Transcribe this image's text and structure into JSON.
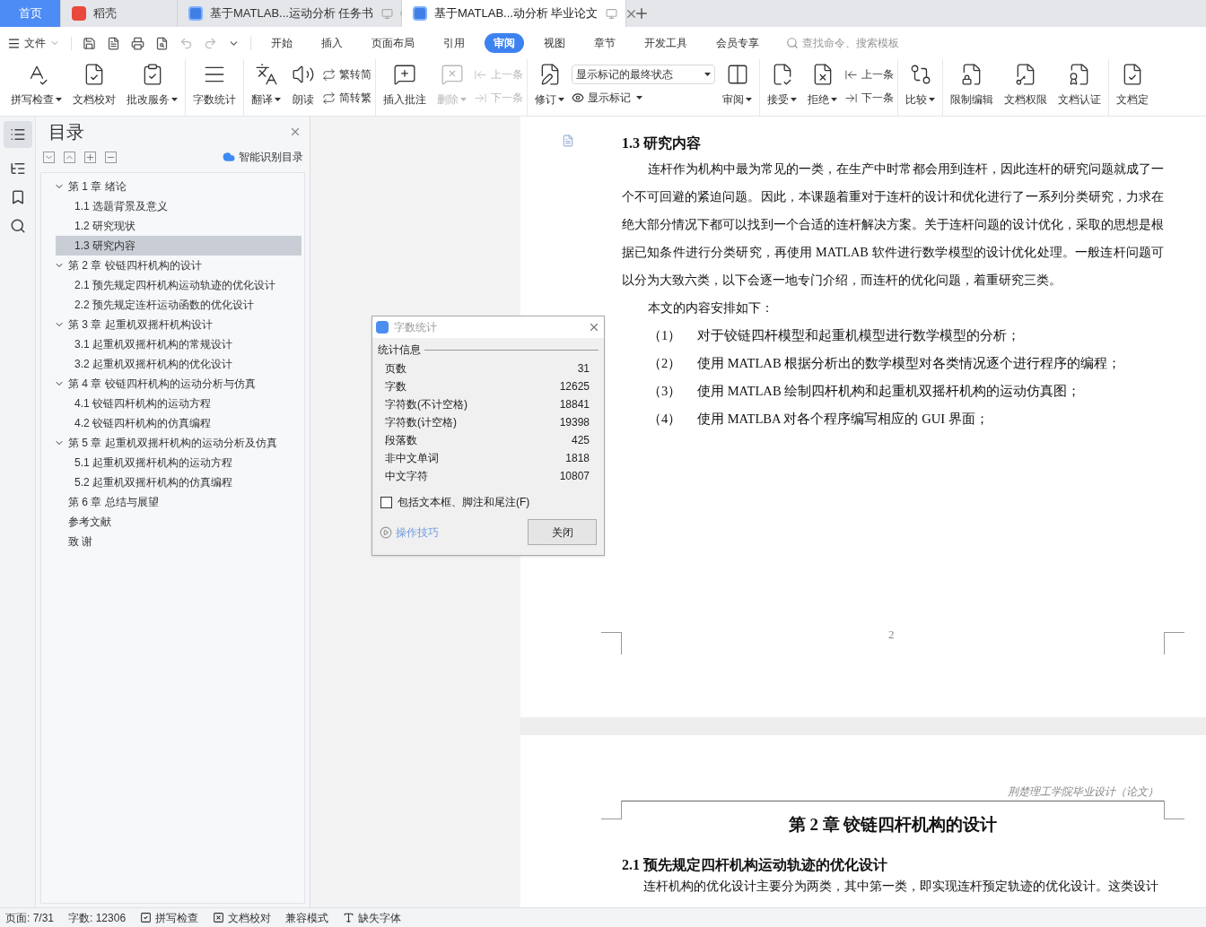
{
  "tabs": [
    {
      "kind": "home",
      "label": "首页",
      "selected": false
    },
    {
      "kind": "app",
      "label": "稻壳",
      "selected": false
    },
    {
      "kind": "doc",
      "label": "基于MATLAB...运动分析 任务书",
      "selected": false
    },
    {
      "kind": "doc",
      "label": "基于MATLAB...动分析 毕业论文",
      "selected": true
    }
  ],
  "menu": {
    "file": "文件",
    "items": [
      {
        "label": "开始",
        "selected": false
      },
      {
        "label": "插入",
        "selected": false
      },
      {
        "label": "页面布局",
        "selected": false
      },
      {
        "label": "引用",
        "selected": false
      },
      {
        "label": "审阅",
        "selected": true
      },
      {
        "label": "视图",
        "selected": false
      },
      {
        "label": "章节",
        "selected": false
      },
      {
        "label": "开发工具",
        "selected": false
      },
      {
        "label": "会员专享",
        "selected": false
      }
    ],
    "search": {
      "placeholder": "查找命令、搜索模板"
    }
  },
  "ribbon": [
    [
      {
        "kind": "large",
        "label": "拼写检查",
        "dropdown": true,
        "disabled": false
      },
      {
        "kind": "large",
        "label": "文档校对",
        "dropdown": false,
        "disabled": false
      },
      {
        "kind": "large",
        "label": "批改服务",
        "dropdown": true,
        "disabled": false
      }
    ],
    [
      {
        "kind": "large",
        "label": "字数统计",
        "dropdown": false,
        "disabled": false
      }
    ],
    [
      {
        "kind": "large",
        "label": "翻译",
        "dropdown": true,
        "disabled": false
      },
      {
        "kind": "large",
        "label": "朗读",
        "dropdown": false,
        "disabled": false
      },
      {
        "kind": "pair",
        "items": [
          {
            "label": "繁转简",
            "disabled": false
          },
          {
            "label": "简转繁",
            "disabled": false
          }
        ]
      }
    ],
    [
      {
        "kind": "large",
        "label": "插入批注",
        "dropdown": false,
        "disabled": false
      },
      {
        "kind": "large",
        "label": "删除",
        "dropdown": true,
        "disabled": true
      },
      {
        "kind": "pair",
        "items": [
          {
            "label": "上一条",
            "disabled": true
          },
          {
            "label": "下一条",
            "disabled": true
          }
        ]
      }
    ],
    [
      {
        "kind": "large",
        "label": "修订",
        "dropdown": true,
        "disabled": false
      },
      {
        "kind": "select",
        "value": "显示标记的最终状态",
        "below": "显示标记"
      },
      {
        "kind": "large",
        "label": "审阅",
        "dropdown": true,
        "disabled": false
      }
    ],
    [
      {
        "kind": "large",
        "label": "接受",
        "dropdown": true,
        "disabled": false
      },
      {
        "kind": "large",
        "label": "拒绝",
        "dropdown": true,
        "disabled": false
      },
      {
        "kind": "pair",
        "items": [
          {
            "label": "上一条",
            "disabled": false
          },
          {
            "label": "下一条",
            "disabled": false
          }
        ]
      }
    ],
    [
      {
        "kind": "large",
        "label": "比较",
        "dropdown": true,
        "disabled": false
      }
    ],
    [
      {
        "kind": "large",
        "label": "限制编辑",
        "dropdown": false,
        "disabled": false
      },
      {
        "kind": "large",
        "label": "文档权限",
        "dropdown": false,
        "disabled": false
      },
      {
        "kind": "large",
        "label": "文档认证",
        "dropdown": false,
        "disabled": false
      }
    ],
    [
      {
        "kind": "large",
        "label": "文档定",
        "dropdown": false,
        "disabled": false
      }
    ]
  ],
  "toc": {
    "title": "目录",
    "smart": "智能识别目录",
    "items": [
      {
        "label": "第 1 章  绪论",
        "expanded": true,
        "selected": false,
        "children": [
          {
            "label": "1.1  选题背景及意义",
            "selected": false
          },
          {
            "label": "1.2  研究现状",
            "selected": false
          },
          {
            "label": "1.3  研究内容",
            "selected": true
          }
        ]
      },
      {
        "label": "第 2 章  铰链四杆机构的设计",
        "expanded": true,
        "selected": false,
        "children": [
          {
            "label": "2.1  预先规定四杆机构运动轨迹的优化设计",
            "selected": false
          },
          {
            "label": "2.2  预先规定连杆运动函数的优化设计",
            "selected": false
          }
        ]
      },
      {
        "label": "第 3 章  起重机双摇杆机构设计",
        "expanded": true,
        "selected": false,
        "children": [
          {
            "label": "3.1  起重机双摇杆机构的常规设计",
            "selected": false
          },
          {
            "label": "3.2  起重机双摇杆机构的优化设计",
            "selected": false
          }
        ]
      },
      {
        "label": "第 4 章  铰链四杆机构的运动分析与仿真",
        "expanded": true,
        "selected": false,
        "children": [
          {
            "label": "4.1  铰链四杆机构的运动方程",
            "selected": false
          },
          {
            "label": "4.2 铰链四杆机构的仿真编程",
            "selected": false
          }
        ]
      },
      {
        "label": "第 5 章  起重机双摇杆机构的运动分析及仿真",
        "expanded": true,
        "selected": false,
        "children": [
          {
            "label": "5.1  起重机双摇杆机构的运动方程",
            "selected": false
          },
          {
            "label": "5.2 起重机双摇杆机构的仿真编程",
            "selected": false
          }
        ]
      },
      {
        "label": "第 6 章  总结与展望",
        "selected": false
      },
      {
        "label": "参考文献",
        "selected": false
      },
      {
        "label": "致    谢",
        "selected": false
      }
    ]
  },
  "dialog": {
    "title": "字数统计",
    "section": "统计信息",
    "rows": [
      {
        "label": "页数",
        "value": "31"
      },
      {
        "label": "字数",
        "value": "12625"
      },
      {
        "label": "字符数(不计空格)",
        "value": "18841"
      },
      {
        "label": "字符数(计空格)",
        "value": "19398"
      },
      {
        "label": "段落数",
        "value": "425"
      },
      {
        "label": "非中文单词",
        "value": "1818"
      },
      {
        "label": "中文字符",
        "value": "10807"
      }
    ],
    "checkbox": {
      "label": "包括文本框、脚注和尾注(F)",
      "checked": false
    },
    "tips": "操作技巧",
    "close": "关闭"
  },
  "page1": {
    "heading": "1.3  研究内容",
    "paragraphs": [
      "连杆作为机构中最为常见的一类，在生产中时常都会用到连杆，因此连杆的研究问题就成了一个不可回避的紧迫问题。因此，本课题着重对于连杆的设计和优化进行了一系列分类研究，力求在绝大部分情况下都可以找到一个合适的连杆解决方案。关于连杆问题的设计优化，采取的思想是根据已知条件进行分类研究，再使用 MATLAB 软件进行数学模型的设计优化处理。一般连杆问题可以分为大致六类，以下会逐一地专门介绍，而连杆的优化问题，着重研究三类。",
      "本文的内容安排如下："
    ],
    "list": [
      {
        "num": "（1）",
        "text": "对于铰链四杆模型和起重机模型进行数学模型的分析；"
      },
      {
        "num": "（2）",
        "text": "使用 MATLAB 根据分析出的数学模型对各类情况逐个进行程序的编程；"
      },
      {
        "num": "（3）",
        "text": "使用 MATLAB 绘制四杆机构和起重机双摇杆机构的运动仿真图；"
      },
      {
        "num": "（4）",
        "text": "使用 MATLBA 对各个程序编写相应的 GUI 界面；"
      }
    ],
    "page_number": "2"
  },
  "page2": {
    "header": "荆楚理工学院毕业设计（论文）",
    "title": "第 2 章  铰链四杆机构的设计",
    "heading": "2.1  预先规定四杆机构运动轨迹的优化设计",
    "paragraph": "连杆机构的优化设计主要分为两类，其中第一类，即实现连杆预定轨迹的优化设计。这类设计"
  },
  "status": [
    {
      "kind": "text",
      "label": "页面: 7/31"
    },
    {
      "kind": "text",
      "label": "字数: 12306"
    },
    {
      "kind": "check",
      "label": "拼写检查"
    },
    {
      "kind": "cross",
      "label": "文档校对"
    },
    {
      "kind": "text",
      "label": "兼容模式"
    },
    {
      "kind": "font",
      "label": "缺失字体"
    }
  ]
}
